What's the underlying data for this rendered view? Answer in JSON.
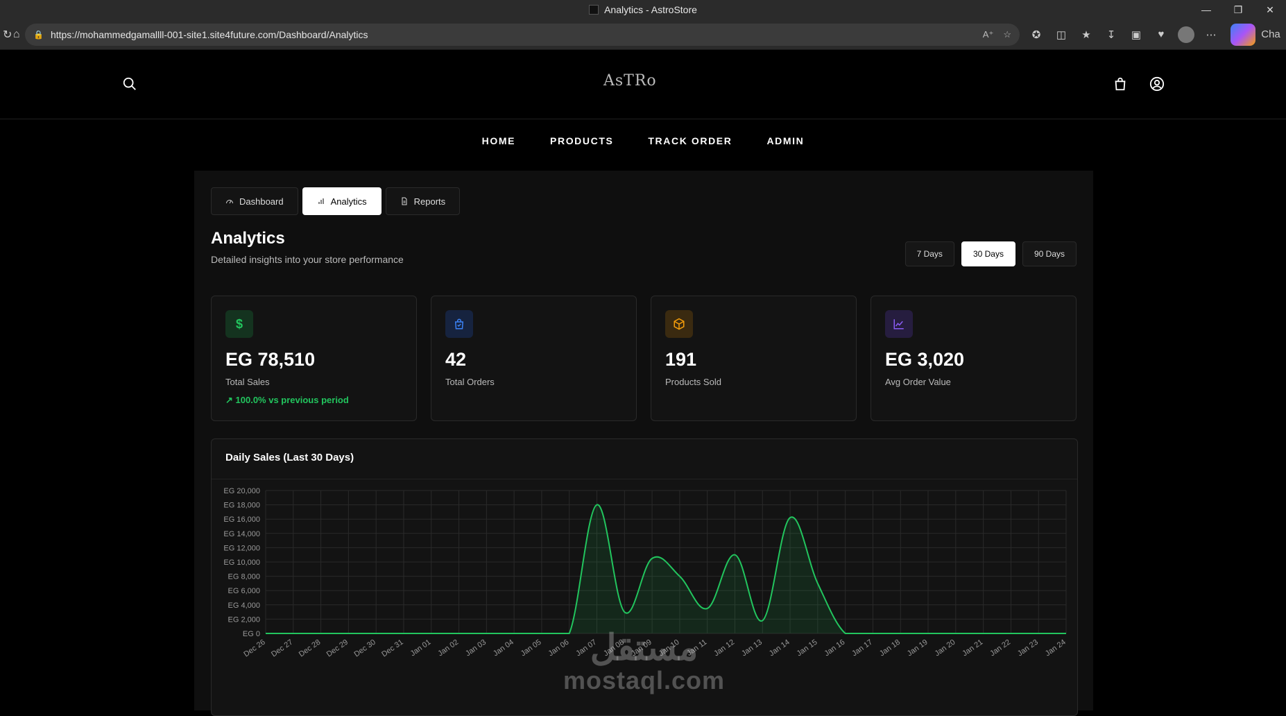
{
  "browser": {
    "tab_title": "Analytics - AstroStore",
    "url": "https://mohammedgamallll-001-site1.site4future.com/Dashboard/Analytics",
    "copilot_label": "Cha"
  },
  "header": {
    "logo_text": "AsTRo"
  },
  "nav": {
    "items": [
      "HOME",
      "PRODUCTS",
      "TRACK ORDER",
      "ADMIN"
    ]
  },
  "tabs": [
    {
      "label": "Dashboard"
    },
    {
      "label": "Analytics"
    },
    {
      "label": "Reports"
    }
  ],
  "page": {
    "title": "Analytics",
    "subtitle": "Detailed insights into your store performance"
  },
  "range": {
    "options": [
      "7 Days",
      "30 Days",
      "90 Days"
    ],
    "selected": "30 Days"
  },
  "cards": [
    {
      "icon": "dollar-icon",
      "glyph": "$",
      "value": "EG 78,510",
      "label": "Total Sales",
      "trend": "100.0% vs previous period",
      "color": "#22c55e",
      "bg": "#14331f"
    },
    {
      "icon": "shopping-bag-icon",
      "glyph": "",
      "value": "42",
      "label": "Total Orders",
      "trend": "",
      "color": "#3b82f6",
      "bg": "#16233f"
    },
    {
      "icon": "package-icon",
      "glyph": "",
      "value": "191",
      "label": "Products Sold",
      "trend": "",
      "color": "#f59e0b",
      "bg": "#3a2a10"
    },
    {
      "icon": "chart-line-icon",
      "glyph": "",
      "value": "EG 3,020",
      "label": "Avg Order Value",
      "trend": "",
      "color": "#8b5cf6",
      "bg": "#261d3f"
    }
  ],
  "chart_title": "Daily Sales (Last 30 Days)",
  "chart_data": {
    "type": "area",
    "title": "Daily Sales (Last 30 Days)",
    "x": [
      "Dec 26",
      "Dec 27",
      "Dec 28",
      "Dec 29",
      "Dec 30",
      "Dec 31",
      "Jan 01",
      "Jan 02",
      "Jan 03",
      "Jan 04",
      "Jan 05",
      "Jan 06",
      "Jan 07",
      "Jan 08",
      "Jan 09",
      "Jan 10",
      "Jan 11",
      "Jan 12",
      "Jan 13",
      "Jan 14",
      "Jan 15",
      "Jan 16",
      "Jan 17",
      "Jan 18",
      "Jan 19",
      "Jan 20",
      "Jan 21",
      "Jan 22",
      "Jan 23",
      "Jan 24"
    ],
    "values": [
      0,
      0,
      0,
      0,
      0,
      0,
      0,
      0,
      0,
      0,
      0,
      0,
      18000,
      3000,
      10500,
      8000,
      3500,
      11000,
      1800,
      16200,
      7000,
      0,
      0,
      0,
      0,
      0,
      0,
      0,
      0,
      0
    ],
    "y_ticks": [
      "EG 0",
      "EG 2,000",
      "EG 4,000",
      "EG 6,000",
      "EG 8,000",
      "EG 10,000",
      "EG 12,000",
      "EG 14,000",
      "EG 16,000",
      "EG 18,000",
      "EG 20,000"
    ],
    "ylim": [
      0,
      20000
    ],
    "color": "#22c55e",
    "grid": true
  },
  "watermark": {
    "arabic": "مستقل",
    "latin": "mostaql.com"
  }
}
